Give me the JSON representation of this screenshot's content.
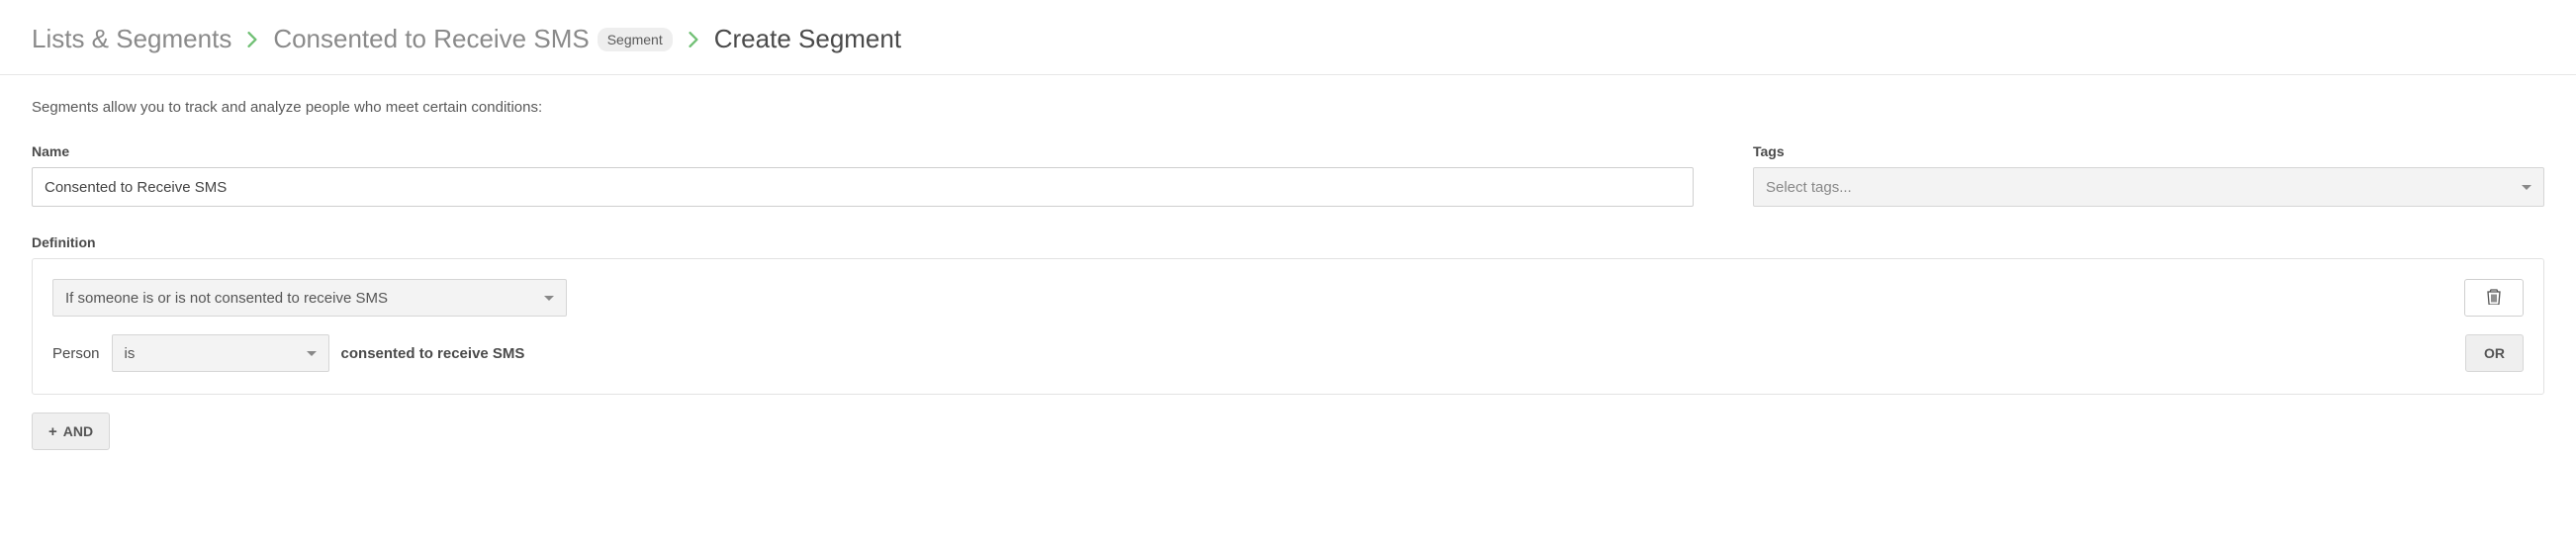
{
  "breadcrumb": {
    "root": "Lists & Segments",
    "segment_name": "Consented to Receive SMS",
    "segment_badge": "Segment",
    "current": "Create Segment"
  },
  "intro": "Segments allow you to track and analyze people who meet certain conditions:",
  "fields": {
    "name_label": "Name",
    "name_value": "Consented to Receive SMS",
    "tags_label": "Tags",
    "tags_placeholder": "Select tags..."
  },
  "definition": {
    "label": "Definition",
    "condition_select": "If someone is or is not consented to receive SMS",
    "person_label": "Person",
    "operator_value": "is",
    "suffix": "consented to receive SMS",
    "or_label": "OR",
    "and_label": "AND"
  }
}
